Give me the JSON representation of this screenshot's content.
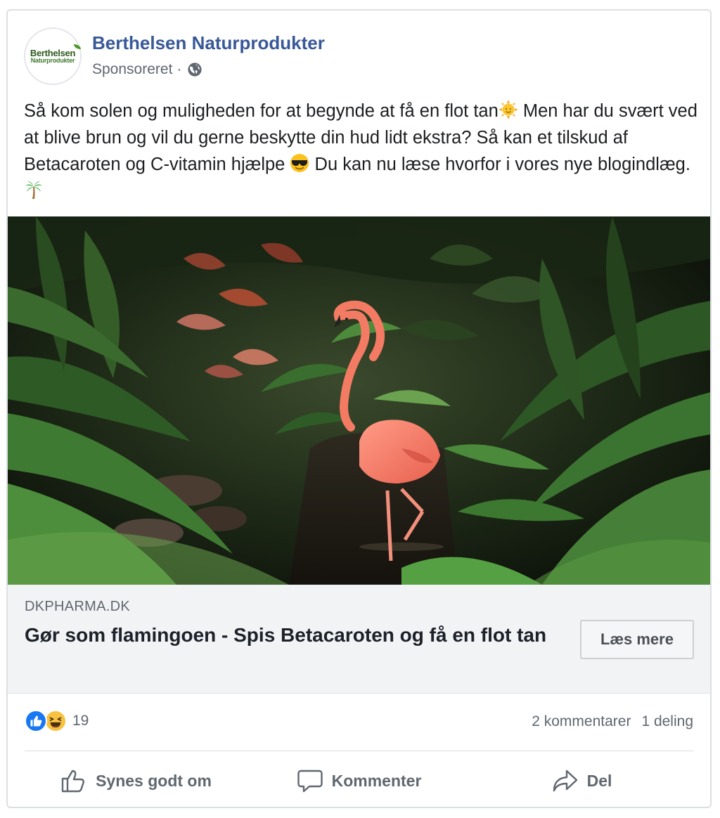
{
  "post": {
    "page_name": "Berthelsen Naturprodukter",
    "logo_text_top": "Berthelsen",
    "logo_text_bottom": "Naturprodukter",
    "sponsored_label": "Sponsoreret",
    "separator": "·",
    "audience_icon": "globe-icon",
    "text_1": "Så kom solen og muligheden for at begynde at få en flot tan",
    "emoji_1": "sun-with-face-emoji",
    "text_2": " Men har du svært ved at blive brun og vil du gerne beskytte din hud lidt ekstra? Så kan et tilskud af Betacaroten og C-vitamin hjælpe ",
    "emoji_2": "smiling-face-with-sunglasses-emoji",
    "text_3": " Du kan nu læse hvorfor i vores nye blogindlæg. ",
    "emoji_3": "palm-tree-emoji"
  },
  "link": {
    "domain": "DKPHARMA.DK",
    "headline": "Gør som flamingoen - Spis Betacaroten og få en flot tan",
    "cta_label": "Læs mere"
  },
  "engagement": {
    "reaction_icons": [
      "like-icon",
      "haha-icon"
    ],
    "reaction_count": "19",
    "comments": "2 kommentarer",
    "shares": "1 deling"
  },
  "actions": {
    "like": "Synes godt om",
    "comment": "Kommenter",
    "share": "Del"
  },
  "colors": {
    "page_name": "#385898",
    "meta_text": "#606770",
    "like_blue": "#1877f2",
    "haha_yellow": "#f7c23f",
    "link_bg": "#f2f3f5"
  }
}
